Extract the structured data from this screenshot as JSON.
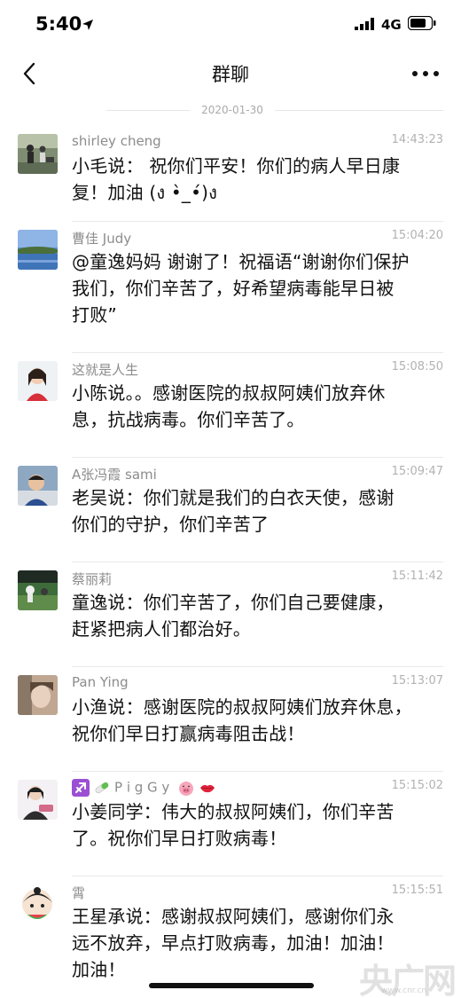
{
  "status": {
    "time": "5:40",
    "network": "4G"
  },
  "nav": {
    "title": "群聊"
  },
  "date_separator": "2020-01-30",
  "messages": [
    {
      "sender": "shirley cheng",
      "time": "14:43:23",
      "lines": [
        "小毛说： 祝你们平安！你们的病人早日康",
        "复！加油 (ง •̀_•́)ง"
      ]
    },
    {
      "sender": "曹佳 Judy",
      "time": "15:04:20",
      "lines": [
        "@童逸妈妈 谢谢了！祝福语“谢谢你们保护",
        "我们，你们辛苦了，好希望病毒能早日被",
        "打败”"
      ]
    },
    {
      "sender": "这就是人生",
      "time": "15:08:50",
      "lines": [
        "小陈说。。感谢医院的叔叔阿姨们放弃休",
        "息，抗战病毒。你们辛苦了。"
      ]
    },
    {
      "sender": "A张冯霞 sami",
      "time": "15:09:47",
      "lines": [
        "老吴说：你们就是我们的白衣天使，感谢",
        "你们的守护，你们辛苦了"
      ]
    },
    {
      "sender": "蔡丽莉",
      "time": "15:11:42",
      "lines": [
        "童逸说：你们辛苦了，你们自己要健康，",
        "赶紧把病人们都治好。"
      ]
    },
    {
      "sender": "Pan Ying",
      "time": "15:13:07",
      "lines": [
        "小渔说：感谢医院的叔叔阿姨们放弃休息，",
        "祝你们早日打赢病毒阻击战！"
      ]
    },
    {
      "sender": "P i g G y",
      "time": "15:15:02",
      "lines": [
        "小姜同学：伟大的叔叔阿姨们，你们辛苦",
        "了。祝你们早日打败病毒！"
      ]
    },
    {
      "sender": "霄",
      "time": "15:15:51",
      "lines": [
        "王星承说：感谢叔叔阿姨们，感谢你们永",
        "远不放弃，早点打败病毒，加油！加油！",
        "加油！"
      ]
    }
  ],
  "watermark": {
    "text": "央广网",
    "sub": "www.cnr.cn"
  },
  "icons": {
    "back": "chevron-left-icon",
    "more": "more-dots-icon",
    "signal": "signal-icon",
    "battery": "battery-icon",
    "location": "location-arrow-icon"
  }
}
